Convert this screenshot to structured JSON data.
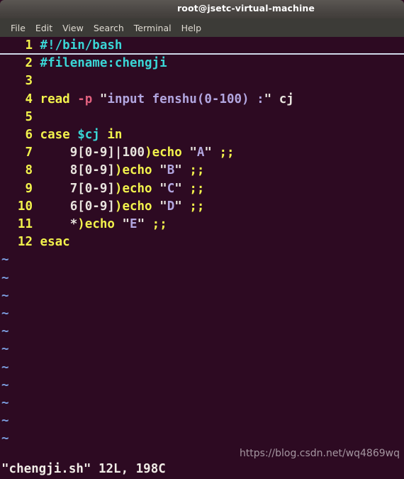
{
  "window": {
    "title": "root@jsetc-virtual-machine"
  },
  "menubar": {
    "items": [
      {
        "label": "File"
      },
      {
        "label": "Edit"
      },
      {
        "label": "View"
      },
      {
        "label": "Search"
      },
      {
        "label": "Terminal"
      },
      {
        "label": "Help"
      }
    ]
  },
  "editor": {
    "filler_char": "~",
    "filler_count": 11,
    "lines": [
      {
        "number": "1",
        "cursorline": true,
        "tokens": [
          {
            "text": "#!/bin/bash",
            "cls": "c-comment"
          }
        ]
      },
      {
        "number": "2",
        "cursorline": false,
        "tokens": [
          {
            "text": "#filename:chengji",
            "cls": "c-comment"
          }
        ]
      },
      {
        "number": "3",
        "cursorline": false,
        "tokens": []
      },
      {
        "number": "4",
        "cursorline": false,
        "tokens": [
          {
            "text": "read ",
            "cls": "c-keyword"
          },
          {
            "text": "-p",
            "cls": "c-flag"
          },
          {
            "text": " ",
            "cls": "c-plain"
          },
          {
            "text": "\"",
            "cls": "c-quote"
          },
          {
            "text": "input fenshu(0-100) :",
            "cls": "c-string"
          },
          {
            "text": "\"",
            "cls": "c-quote"
          },
          {
            "text": " cj",
            "cls": "c-plain"
          }
        ]
      },
      {
        "number": "5",
        "cursorline": false,
        "tokens": []
      },
      {
        "number": "6",
        "cursorline": false,
        "tokens": [
          {
            "text": "case ",
            "cls": "c-keyword"
          },
          {
            "text": "$cj",
            "cls": "c-var"
          },
          {
            "text": " ",
            "cls": "c-plain"
          },
          {
            "text": "in",
            "cls": "c-keyword"
          }
        ]
      },
      {
        "number": "7",
        "cursorline": false,
        "tokens": [
          {
            "text": "    9[0-9]|100",
            "cls": "c-plain"
          },
          {
            "text": ")",
            "cls": "c-punct"
          },
          {
            "text": "echo",
            "cls": "c-keyword"
          },
          {
            "text": " ",
            "cls": "c-plain"
          },
          {
            "text": "\"",
            "cls": "c-quote"
          },
          {
            "text": "A",
            "cls": "c-string"
          },
          {
            "text": "\"",
            "cls": "c-quote"
          },
          {
            "text": " ",
            "cls": "c-plain"
          },
          {
            "text": ";;",
            "cls": "c-punct"
          }
        ]
      },
      {
        "number": "8",
        "cursorline": false,
        "tokens": [
          {
            "text": "    8[0-9]",
            "cls": "c-plain"
          },
          {
            "text": ")",
            "cls": "c-punct"
          },
          {
            "text": "echo",
            "cls": "c-keyword"
          },
          {
            "text": " ",
            "cls": "c-plain"
          },
          {
            "text": "\"",
            "cls": "c-quote"
          },
          {
            "text": "B",
            "cls": "c-string"
          },
          {
            "text": "\"",
            "cls": "c-quote"
          },
          {
            "text": " ",
            "cls": "c-plain"
          },
          {
            "text": ";;",
            "cls": "c-punct"
          }
        ]
      },
      {
        "number": "9",
        "cursorline": false,
        "tokens": [
          {
            "text": "    7[0-9]",
            "cls": "c-plain"
          },
          {
            "text": ")",
            "cls": "c-punct"
          },
          {
            "text": "echo",
            "cls": "c-keyword"
          },
          {
            "text": " ",
            "cls": "c-plain"
          },
          {
            "text": "\"",
            "cls": "c-quote"
          },
          {
            "text": "C",
            "cls": "c-string"
          },
          {
            "text": "\"",
            "cls": "c-quote"
          },
          {
            "text": " ",
            "cls": "c-plain"
          },
          {
            "text": ";;",
            "cls": "c-punct"
          }
        ]
      },
      {
        "number": "10",
        "cursorline": false,
        "tokens": [
          {
            "text": "    6[0-9]",
            "cls": "c-plain"
          },
          {
            "text": ")",
            "cls": "c-punct"
          },
          {
            "text": "echo",
            "cls": "c-keyword"
          },
          {
            "text": " ",
            "cls": "c-plain"
          },
          {
            "text": "\"",
            "cls": "c-quote"
          },
          {
            "text": "D",
            "cls": "c-string"
          },
          {
            "text": "\"",
            "cls": "c-quote"
          },
          {
            "text": " ",
            "cls": "c-plain"
          },
          {
            "text": ";;",
            "cls": "c-punct"
          }
        ]
      },
      {
        "number": "11",
        "cursorline": false,
        "tokens": [
          {
            "text": "    *",
            "cls": "c-plain"
          },
          {
            "text": ")",
            "cls": "c-punct"
          },
          {
            "text": "echo",
            "cls": "c-keyword"
          },
          {
            "text": " ",
            "cls": "c-plain"
          },
          {
            "text": "\"",
            "cls": "c-quote"
          },
          {
            "text": "E",
            "cls": "c-string"
          },
          {
            "text": "\"",
            "cls": "c-quote"
          },
          {
            "text": " ",
            "cls": "c-plain"
          },
          {
            "text": ";;",
            "cls": "c-punct"
          }
        ]
      },
      {
        "number": "12",
        "cursorline": false,
        "tokens": [
          {
            "text": "esac",
            "cls": "c-keyword"
          }
        ]
      }
    ]
  },
  "statusline": {
    "text": "\"chengji.sh\" 12L, 198C"
  },
  "watermark": {
    "text": "https://blog.csdn.net/wq4869wq"
  },
  "colors": {
    "background": "#2d0a22",
    "titlebar": "#4b4744",
    "menubar": "#3c3b37",
    "linenumber": "#f2f24c",
    "comment": "#3ad6d6",
    "keyword": "#f2f24c",
    "string": "#b2a6e0",
    "flag": "#e0607e",
    "tilde": "#7b9cdd",
    "text": "#e8e4de"
  }
}
